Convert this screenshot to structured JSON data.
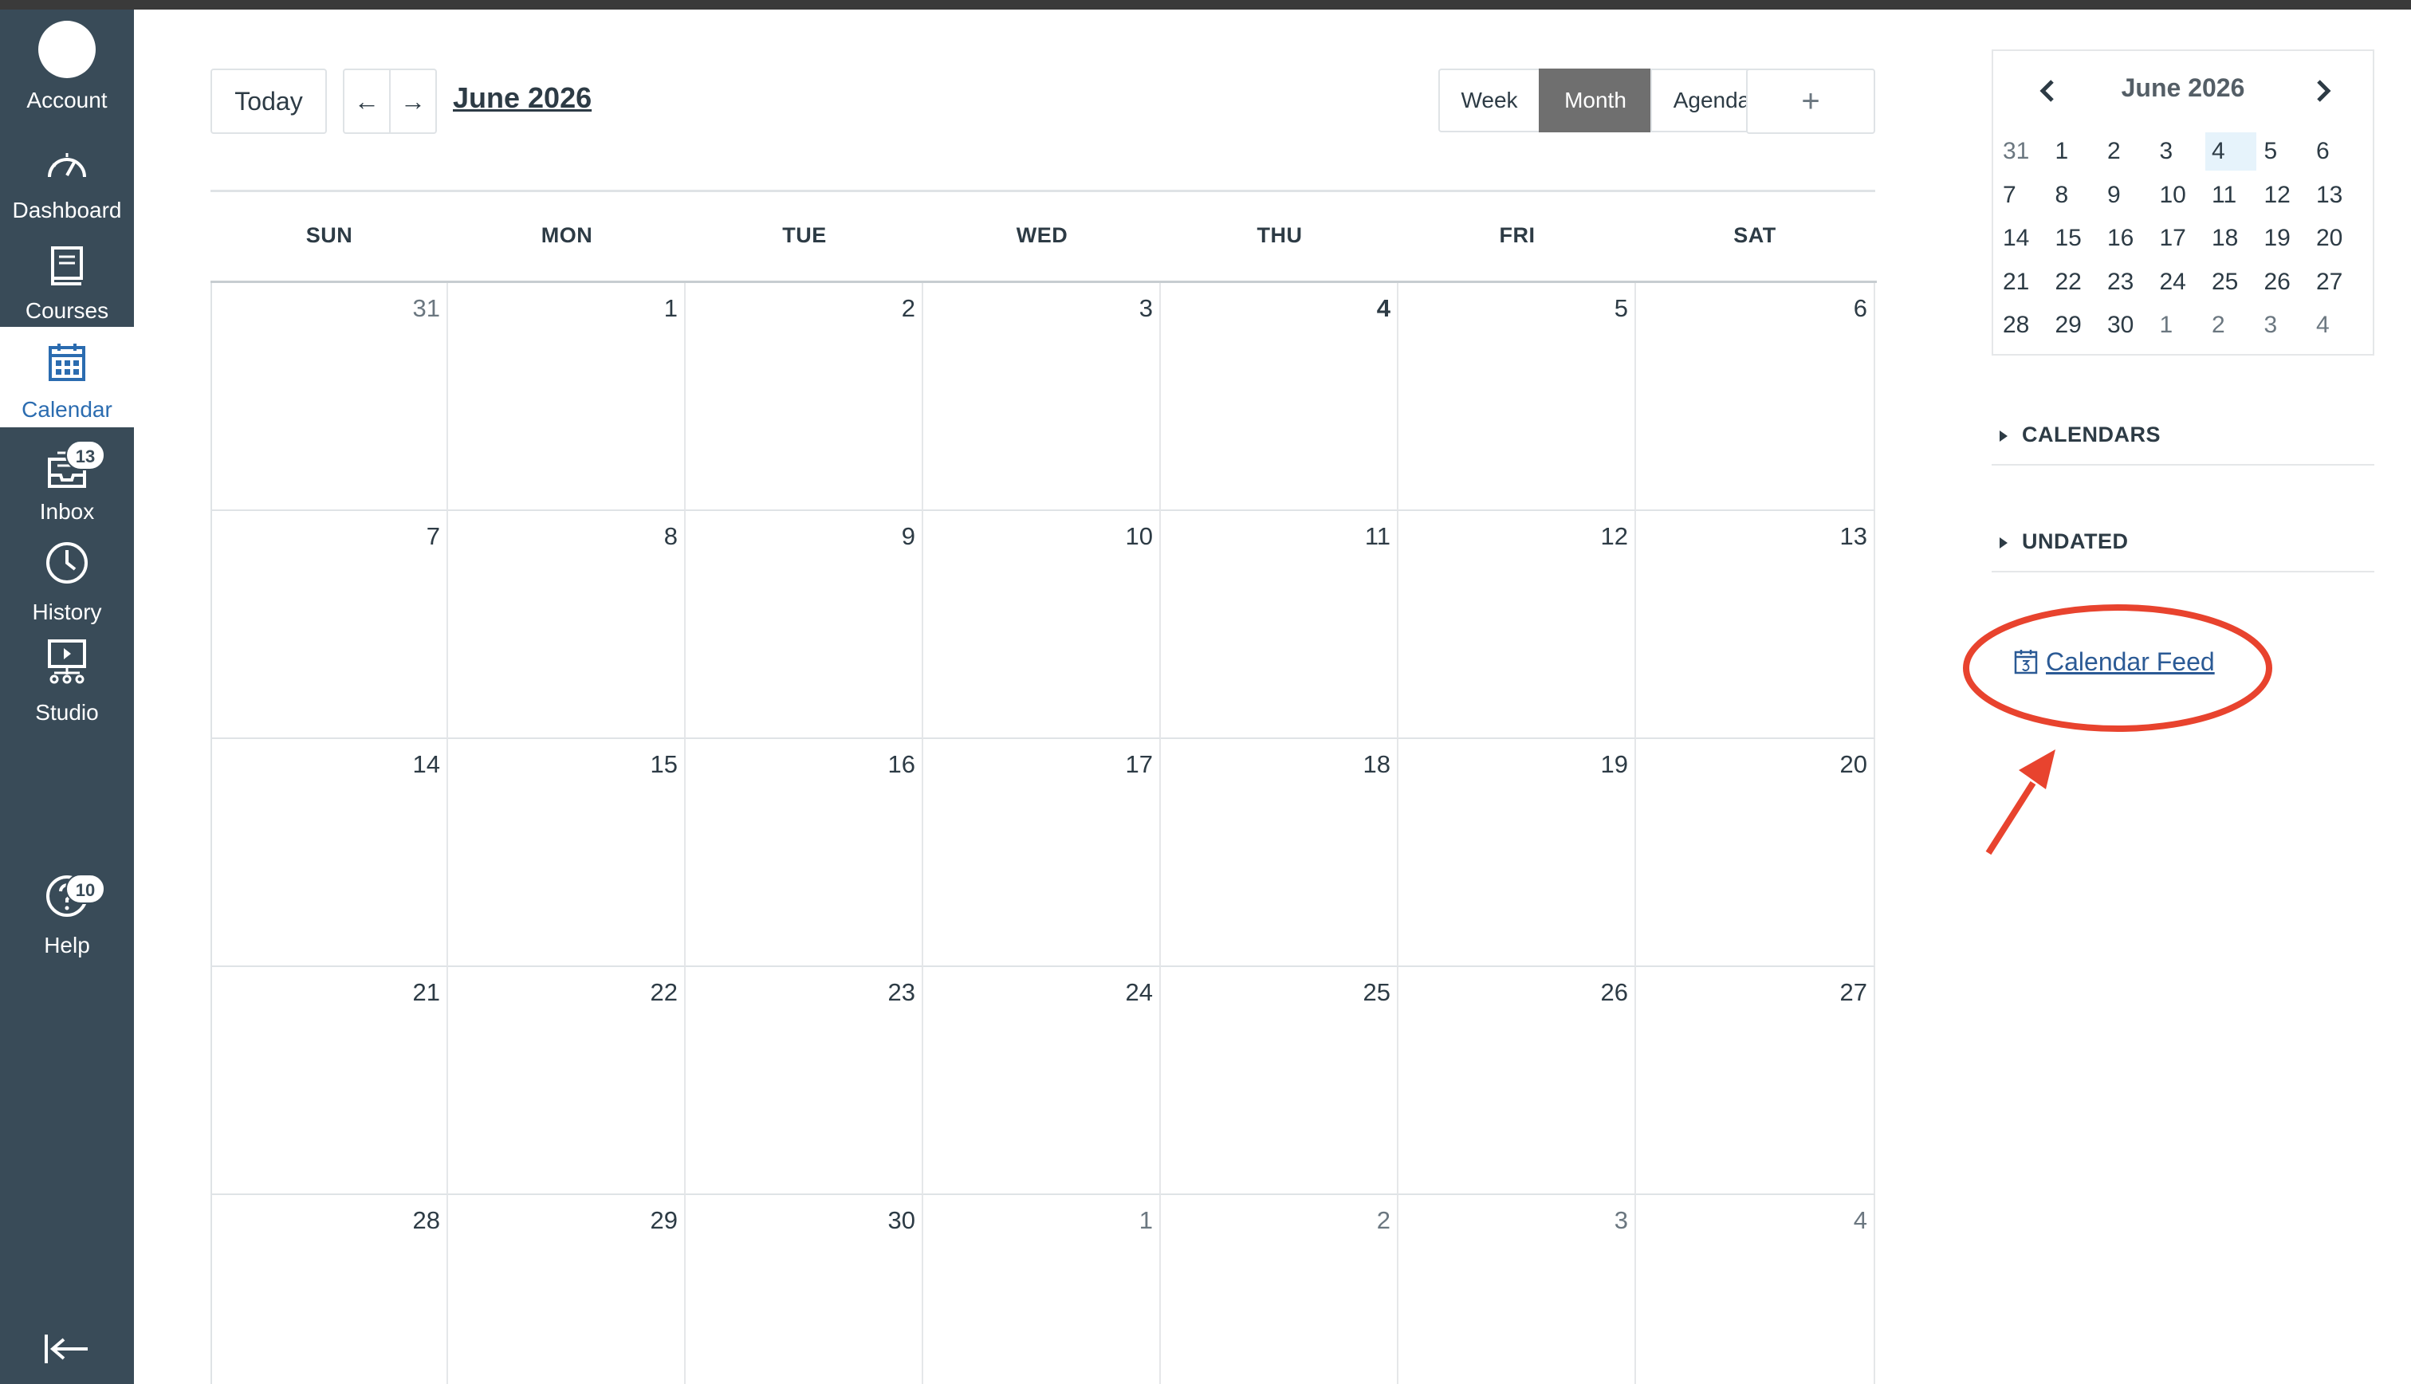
{
  "nav": {
    "items": [
      {
        "key": "account",
        "label": "Account",
        "icon": "avatar"
      },
      {
        "key": "dashboard",
        "label": "Dashboard",
        "icon": "dashboard-icon"
      },
      {
        "key": "courses",
        "label": "Courses",
        "icon": "book-icon"
      },
      {
        "key": "calendar",
        "label": "Calendar",
        "icon": "calendar-icon",
        "active": true
      },
      {
        "key": "inbox",
        "label": "Inbox",
        "icon": "inbox-icon",
        "badge": "13"
      },
      {
        "key": "history",
        "label": "History",
        "icon": "clock-icon"
      },
      {
        "key": "studio",
        "label": "Studio",
        "icon": "studio-icon"
      },
      {
        "key": "help",
        "label": "Help",
        "icon": "help-icon",
        "badge": "10"
      }
    ],
    "collapse_icon": "collapse-icon"
  },
  "header": {
    "today_label": "Today",
    "prev_symbol": "←",
    "next_symbol": "→",
    "month_title": "June 2026",
    "views": [
      "Week",
      "Month",
      "Agenda"
    ],
    "selected_view": "Month",
    "add_symbol": "+"
  },
  "grid": {
    "weekdays": [
      "SUN",
      "MON",
      "TUE",
      "WED",
      "THU",
      "FRI",
      "SAT"
    ],
    "weeks": [
      [
        "31",
        "1",
        "2",
        "3",
        "4",
        "5",
        "6"
      ],
      [
        "7",
        "8",
        "9",
        "10",
        "11",
        "12",
        "13"
      ],
      [
        "14",
        "15",
        "16",
        "17",
        "18",
        "19",
        "20"
      ],
      [
        "21",
        "22",
        "23",
        "24",
        "25",
        "26",
        "27"
      ],
      [
        "28",
        "29",
        "30",
        "1",
        "2",
        "3",
        "4"
      ]
    ],
    "today": "4"
  },
  "mini": {
    "title": "June 2026",
    "weeks": [
      [
        "31",
        "1",
        "2",
        "3",
        "4",
        "5",
        "6"
      ],
      [
        "7",
        "8",
        "9",
        "10",
        "11",
        "12",
        "13"
      ],
      [
        "14",
        "15",
        "16",
        "17",
        "18",
        "19",
        "20"
      ],
      [
        "21",
        "22",
        "23",
        "24",
        "25",
        "26",
        "27"
      ],
      [
        "28",
        "29",
        "30",
        "1",
        "2",
        "3",
        "4"
      ]
    ]
  },
  "sidebar": {
    "calendars_label": "CALENDARS",
    "undated_label": "UNDATED",
    "feed_label": "Calendar Feed",
    "feed_icon": "calendar-feed-icon"
  },
  "colors": {
    "nav_bg": "#394b58",
    "accent": "#2b6cb0",
    "annotation": "#e8432e"
  }
}
